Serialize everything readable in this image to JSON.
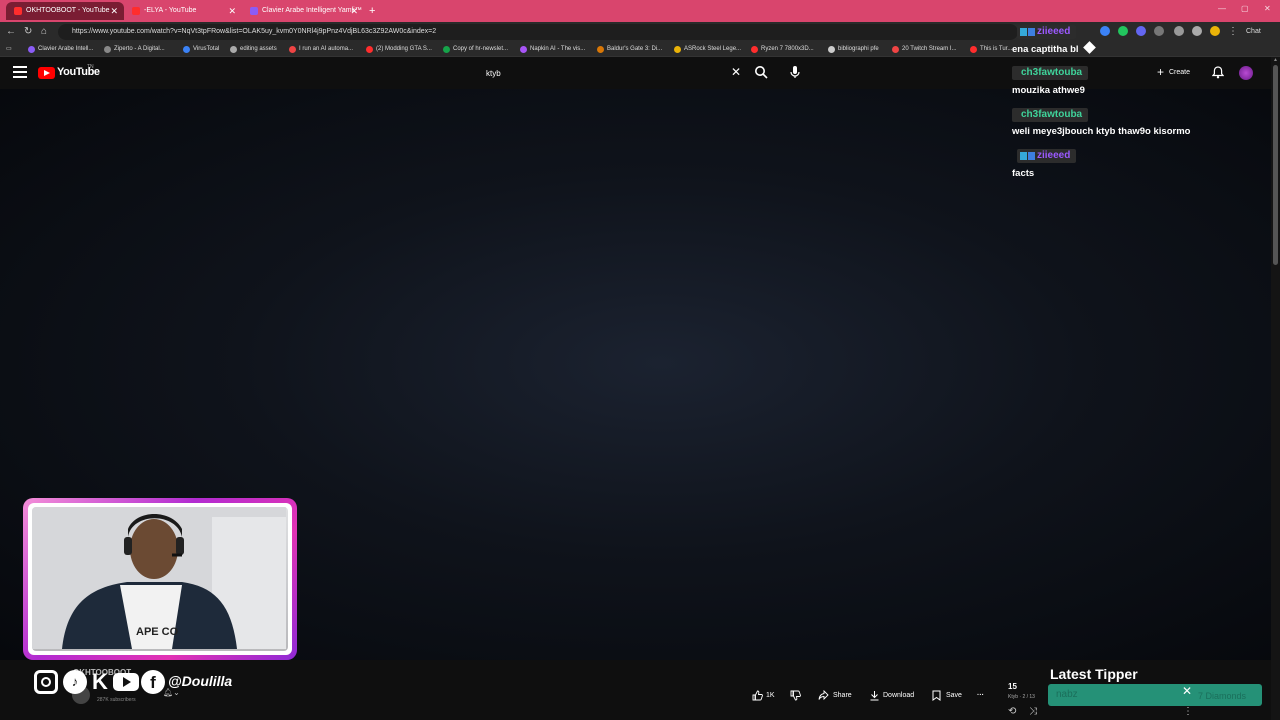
{
  "browser": {
    "tabs": [
      {
        "title": "OKHTOOBOOT - YouTube",
        "color": "#ff2d2d",
        "active": true
      },
      {
        "title": "-ELYA - YouTube",
        "color": "#ff2d2d",
        "active": false
      },
      {
        "title": "Clavier Arabe Intelligent Yamli™",
        "color": "#8b5cf6",
        "active": false
      }
    ],
    "url": "https://www.youtube.com/watch?v=NqVt3tpFRow&list=OLAK5uy_kvm0Y0NRl4j9pPnz4VdjBL63c3Z92AW0c&index=2",
    "chat_button": "Chat",
    "bookmarks": [
      "Clavier Arabe Intell...",
      "Ziperto - A Digital...",
      "VirusTotal",
      "editing assets",
      "I run an AI automa...",
      "(2) Modding GTA S...",
      "Copy of hr-newslet...",
      "Napkin AI - The vis...",
      "Baldur's Gate 3: Di...",
      "ASRock Steel Lege...",
      "Ryzen 7 7800x3D...",
      "bibliographi pfe",
      "20 Twitch Stream I...",
      "This is Tur..."
    ]
  },
  "youtube": {
    "logo_text": "YouTube",
    "country": "TN",
    "search_value": "ktyb",
    "create_label": "Create"
  },
  "video_meta": {
    "channel_name": "OKHTOOBOOT",
    "subscribers": "287K subscribers",
    "like_count": "1K",
    "share_label": "Share",
    "download_label": "Download",
    "save_label": "Save",
    "more_label": "···"
  },
  "playlist": {
    "count": "15",
    "title": "Ktyb · 2 / 13"
  },
  "overlay": {
    "social_handle": "@Doulilla",
    "kick_letter": "K",
    "tiktok_glyph": "♪",
    "facebook_glyph": "f",
    "tipper_title": "Latest Tipper",
    "tipper_name": "nabz",
    "tipper_amount": "7 Diamonds"
  },
  "chat": [
    {
      "user": "ziieeed",
      "user_color": "#9b59ff",
      "message": "ena captitha bl"
    },
    {
      "user": "ch3fawtouba",
      "user_color": "#3fd39a",
      "message": "mouzika athwe9"
    },
    {
      "user": "ch3fawtouba",
      "user_color": "#3fd39a",
      "message": "weli meye3jbouch ktyb thaw9o kisormo"
    },
    {
      "user": "ziieeed",
      "user_color": "#9b59ff",
      "message": "facts"
    }
  ],
  "icons": {
    "menu": "hamburger-icon",
    "search": "magnifier-icon",
    "mic": "microphone-icon",
    "bell": "bell-icon",
    "like": "thumbs-up-icon",
    "dislike": "thumbs-down-icon",
    "share": "share-arrow-icon",
    "download": "download-arrow-icon",
    "save": "bookmark-plus-icon"
  },
  "colors": {
    "tab_bar": "#d9456d",
    "youtube_red": "#ff0000",
    "webcam_border": "#e233b4",
    "tipper_bg": "#29a889"
  }
}
